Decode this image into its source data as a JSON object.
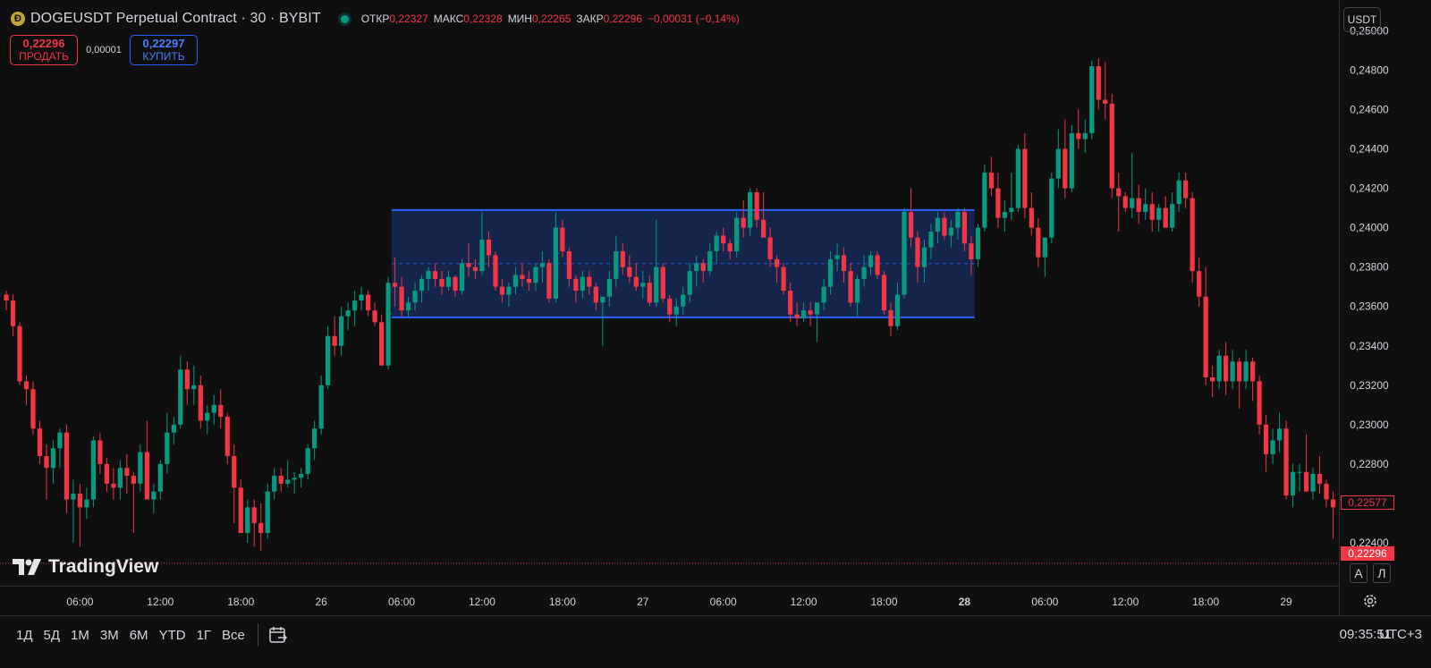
{
  "header": {
    "coin_glyph": "Ð",
    "symbol_title": "DOGEUSDT Perpetual Contract · 30 · BYBIT",
    "ohlc": {
      "open_label": "ОТКР",
      "open_value": "0,22327",
      "high_label": "МАКС",
      "high_value": "0,22328",
      "low_label": "МИН",
      "low_value": "0,22265",
      "close_label": "ЗАКР",
      "close_value": "0,22296",
      "change_value": "−0,00031 (−0,14%)"
    }
  },
  "trade": {
    "sell_price": "0,22296",
    "sell_label": "ПРОДАТЬ",
    "spread": "0,00001",
    "buy_price": "0,22297",
    "buy_label": "КУПИТЬ"
  },
  "currency": "USDT",
  "brand": "TradingView",
  "price_scale_modes": {
    "auto": "A",
    "log": "Л"
  },
  "price_tags": {
    "countdown_price": "0,22577",
    "last_price": "0,22296"
  },
  "timeframes": [
    "1Д",
    "5Д",
    "1М",
    "3М",
    "6М",
    "YTD",
    "1Г",
    "Все"
  ],
  "clock": {
    "time": "09:35:51",
    "tz": "UTC+3"
  },
  "colors": {
    "up": "#089981",
    "down": "#f23645",
    "rectangle": "#2962ff",
    "background": "#0f0f0f"
  },
  "chart_data": {
    "type": "candlestick",
    "interval": "30",
    "y_ticks": [
      "0,25000",
      "0,24800",
      "0,24600",
      "0,24400",
      "0,24200",
      "0,24000",
      "0,23800",
      "0,23600",
      "0,23400",
      "0,23200",
      "0,23000",
      "0,22800",
      "0,22600",
      "0,22400"
    ],
    "y_tick_values": [
      0.25,
      0.248,
      0.246,
      0.244,
      0.242,
      0.24,
      0.238,
      0.236,
      0.234,
      0.232,
      0.23,
      0.228,
      0.226,
      0.224
    ],
    "ylim": [
      0.2225,
      0.2512
    ],
    "x_ticks": [
      {
        "label": "06:00",
        "bar": 11,
        "bold": false
      },
      {
        "label": "12:00",
        "bar": 23,
        "bold": false
      },
      {
        "label": "18:00",
        "bar": 35,
        "bold": false
      },
      {
        "label": "26",
        "bar": 47,
        "bold": false
      },
      {
        "label": "06:00",
        "bar": 59,
        "bold": false
      },
      {
        "label": "12:00",
        "bar": 71,
        "bold": false
      },
      {
        "label": "18:00",
        "bar": 83,
        "bold": false
      },
      {
        "label": "27",
        "bar": 95,
        "bold": false
      },
      {
        "label": "06:00",
        "bar": 107,
        "bold": false
      },
      {
        "label": "12:00",
        "bar": 119,
        "bold": false
      },
      {
        "label": "18:00",
        "bar": 131,
        "bold": false
      },
      {
        "label": "28",
        "bar": 143,
        "bold": true
      },
      {
        "label": "06:00",
        "bar": 155,
        "bold": false
      },
      {
        "label": "12:00",
        "bar": 167,
        "bold": false
      },
      {
        "label": "18:00",
        "bar": 179,
        "bold": false
      },
      {
        "label": "29",
        "bar": 191,
        "bold": false
      }
    ],
    "rectangle": {
      "bar_start": 57.5,
      "bar_end": 144.5,
      "top": 0.2409,
      "bottom": 0.23545,
      "mid": 0.23818
    },
    "last_price": 0.22296,
    "candles": [
      [
        0.2366,
        0.2368,
        0.2358,
        0.2363
      ],
      [
        0.2363,
        0.2366,
        0.2345,
        0.235
      ],
      [
        0.235,
        0.2352,
        0.232,
        0.2322
      ],
      [
        0.2322,
        0.2325,
        0.231,
        0.2318
      ],
      [
        0.2318,
        0.2322,
        0.2295,
        0.2298
      ],
      [
        0.2298,
        0.2302,
        0.228,
        0.2284
      ],
      [
        0.2284,
        0.229,
        0.2262,
        0.2278
      ],
      [
        0.2278,
        0.2292,
        0.227,
        0.2288
      ],
      [
        0.2288,
        0.2298,
        0.2278,
        0.2296
      ],
      [
        0.2296,
        0.23,
        0.2255,
        0.2262
      ],
      [
        0.2262,
        0.2272,
        0.224,
        0.2265
      ],
      [
        0.2265,
        0.227,
        0.2238,
        0.2258
      ],
      [
        0.2258,
        0.2268,
        0.2252,
        0.2262
      ],
      [
        0.2262,
        0.2294,
        0.2258,
        0.2292
      ],
      [
        0.2292,
        0.2296,
        0.2275,
        0.228
      ],
      [
        0.228,
        0.2283,
        0.2266,
        0.227
      ],
      [
        0.227,
        0.2278,
        0.2262,
        0.2268
      ],
      [
        0.2268,
        0.2282,
        0.2262,
        0.2278
      ],
      [
        0.2278,
        0.2285,
        0.2265,
        0.2274
      ],
      [
        0.2274,
        0.2276,
        0.2245,
        0.227
      ],
      [
        0.227,
        0.229,
        0.2266,
        0.2286
      ],
      [
        0.2286,
        0.2302,
        0.228,
        0.2262
      ],
      [
        0.2262,
        0.227,
        0.2255,
        0.2266
      ],
      [
        0.2266,
        0.2282,
        0.2262,
        0.228
      ],
      [
        0.228,
        0.2306,
        0.2275,
        0.2296
      ],
      [
        0.2296,
        0.2304,
        0.229,
        0.23
      ],
      [
        0.23,
        0.2335,
        0.2298,
        0.2328
      ],
      [
        0.2328,
        0.2332,
        0.231,
        0.2318
      ],
      [
        0.2318,
        0.233,
        0.231,
        0.232
      ],
      [
        0.232,
        0.2325,
        0.2298,
        0.2302
      ],
      [
        0.2302,
        0.231,
        0.2295,
        0.2306
      ],
      [
        0.2306,
        0.2315,
        0.23,
        0.231
      ],
      [
        0.231,
        0.2318,
        0.2298,
        0.2304
      ],
      [
        0.2304,
        0.2306,
        0.228,
        0.2284
      ],
      [
        0.2284,
        0.229,
        0.225,
        0.2268
      ],
      [
        0.2268,
        0.2272,
        0.2245,
        0.2245
      ],
      [
        0.2245,
        0.2262,
        0.224,
        0.2258
      ],
      [
        0.2258,
        0.2262,
        0.2238,
        0.225
      ],
      [
        0.225,
        0.226,
        0.2236,
        0.2245
      ],
      [
        0.2245,
        0.227,
        0.2242,
        0.2266
      ],
      [
        0.2266,
        0.2278,
        0.2262,
        0.2274
      ],
      [
        0.2274,
        0.2278,
        0.2266,
        0.227
      ],
      [
        0.227,
        0.2282,
        0.2268,
        0.2272
      ],
      [
        0.2272,
        0.2276,
        0.2265,
        0.2273
      ],
      [
        0.2273,
        0.2278,
        0.2268,
        0.2275
      ],
      [
        0.2275,
        0.229,
        0.2272,
        0.2288
      ],
      [
        0.2288,
        0.2302,
        0.2282,
        0.2298
      ],
      [
        0.2298,
        0.2325,
        0.2295,
        0.232
      ],
      [
        0.232,
        0.235,
        0.2318,
        0.2345
      ],
      [
        0.2345,
        0.2355,
        0.2335,
        0.234
      ],
      [
        0.234,
        0.236,
        0.2335,
        0.2355
      ],
      [
        0.2355,
        0.2362,
        0.2348,
        0.2358
      ],
      [
        0.2358,
        0.2368,
        0.235,
        0.2363
      ],
      [
        0.2363,
        0.237,
        0.2358,
        0.2366
      ],
      [
        0.2366,
        0.2368,
        0.2355,
        0.2358
      ],
      [
        0.2358,
        0.2362,
        0.235,
        0.2352
      ],
      [
        0.2352,
        0.2356,
        0.233,
        0.233
      ],
      [
        0.233,
        0.2375,
        0.2328,
        0.2372
      ],
      [
        0.2372,
        0.2385,
        0.236,
        0.237
      ],
      [
        0.237,
        0.2375,
        0.2355,
        0.2358
      ],
      [
        0.2358,
        0.2365,
        0.2355,
        0.2362
      ],
      [
        0.2362,
        0.2372,
        0.2358,
        0.2368
      ],
      [
        0.2368,
        0.2376,
        0.2362,
        0.2374
      ],
      [
        0.2374,
        0.238,
        0.2368,
        0.2378
      ],
      [
        0.2378,
        0.2382,
        0.237,
        0.2374
      ],
      [
        0.2374,
        0.2378,
        0.2366,
        0.237
      ],
      [
        0.237,
        0.2378,
        0.2368,
        0.2375
      ],
      [
        0.2375,
        0.2376,
        0.2365,
        0.2368
      ],
      [
        0.2368,
        0.2384,
        0.2366,
        0.2382
      ],
      [
        0.2382,
        0.2392,
        0.2375,
        0.238
      ],
      [
        0.238,
        0.2384,
        0.2374,
        0.2378
      ],
      [
        0.2378,
        0.2408,
        0.2376,
        0.2394
      ],
      [
        0.2394,
        0.2398,
        0.238,
        0.2386
      ],
      [
        0.2386,
        0.2388,
        0.2368,
        0.237
      ],
      [
        0.237,
        0.2374,
        0.2362,
        0.2366
      ],
      [
        0.2366,
        0.2372,
        0.236,
        0.237
      ],
      [
        0.237,
        0.238,
        0.2366,
        0.2376
      ],
      [
        0.2376,
        0.2382,
        0.237,
        0.2374
      ],
      [
        0.2374,
        0.2378,
        0.2368,
        0.2372
      ],
      [
        0.2372,
        0.2382,
        0.2368,
        0.238
      ],
      [
        0.238,
        0.2388,
        0.2372,
        0.2382
      ],
      [
        0.2382,
        0.2384,
        0.2362,
        0.2364
      ],
      [
        0.2364,
        0.2408,
        0.2362,
        0.24
      ],
      [
        0.24,
        0.2404,
        0.2385,
        0.2388
      ],
      [
        0.2388,
        0.239,
        0.237,
        0.2374
      ],
      [
        0.2374,
        0.2376,
        0.2362,
        0.2368
      ],
      [
        0.2368,
        0.2378,
        0.2364,
        0.2375
      ],
      [
        0.2375,
        0.2378,
        0.2366,
        0.237
      ],
      [
        0.237,
        0.2372,
        0.2358,
        0.2362
      ],
      [
        0.2362,
        0.2364,
        0.234,
        0.2365
      ],
      [
        0.2365,
        0.2378,
        0.236,
        0.2374
      ],
      [
        0.2374,
        0.2396,
        0.237,
        0.2388
      ],
      [
        0.2388,
        0.2392,
        0.2376,
        0.238
      ],
      [
        0.238,
        0.2386,
        0.2372,
        0.2375
      ],
      [
        0.2375,
        0.2382,
        0.2368,
        0.237
      ],
      [
        0.237,
        0.2378,
        0.2364,
        0.2372
      ],
      [
        0.2372,
        0.2376,
        0.236,
        0.2362
      ],
      [
        0.2362,
        0.2404,
        0.236,
        0.238
      ],
      [
        0.238,
        0.2382,
        0.2362,
        0.2364
      ],
      [
        0.2364,
        0.2366,
        0.2352,
        0.2356
      ],
      [
        0.2356,
        0.2364,
        0.235,
        0.236
      ],
      [
        0.236,
        0.237,
        0.2356,
        0.2366
      ],
      [
        0.2366,
        0.2382,
        0.2362,
        0.2378
      ],
      [
        0.2378,
        0.2386,
        0.237,
        0.2382
      ],
      [
        0.2382,
        0.2384,
        0.2372,
        0.2378
      ],
      [
        0.2378,
        0.2392,
        0.2376,
        0.2388
      ],
      [
        0.2388,
        0.2398,
        0.2382,
        0.2396
      ],
      [
        0.2396,
        0.24,
        0.2388,
        0.2392
      ],
      [
        0.2392,
        0.2394,
        0.2384,
        0.2388
      ],
      [
        0.2388,
        0.2408,
        0.2385,
        0.2405
      ],
      [
        0.2405,
        0.2414,
        0.2395,
        0.24
      ],
      [
        0.24,
        0.242,
        0.2396,
        0.2418
      ],
      [
        0.2418,
        0.242,
        0.24,
        0.2404
      ],
      [
        0.2404,
        0.2418,
        0.24,
        0.2395
      ],
      [
        0.2395,
        0.24,
        0.238,
        0.2384
      ],
      [
        0.2384,
        0.2386,
        0.2372,
        0.238
      ],
      [
        0.238,
        0.2382,
        0.2366,
        0.2368
      ],
      [
        0.2368,
        0.2372,
        0.2352,
        0.2356
      ],
      [
        0.2356,
        0.2362,
        0.235,
        0.2354
      ],
      [
        0.2354,
        0.2362,
        0.2352,
        0.2358
      ],
      [
        0.2358,
        0.2362,
        0.235,
        0.2356
      ],
      [
        0.2356,
        0.2358,
        0.2342,
        0.2362
      ],
      [
        0.2362,
        0.2374,
        0.2358,
        0.237
      ],
      [
        0.237,
        0.2388,
        0.2366,
        0.2384
      ],
      [
        0.2384,
        0.2392,
        0.2378,
        0.2386
      ],
      [
        0.2386,
        0.239,
        0.2372,
        0.2378
      ],
      [
        0.2378,
        0.2382,
        0.236,
        0.2362
      ],
      [
        0.2362,
        0.2376,
        0.2355,
        0.2374
      ],
      [
        0.2374,
        0.2386,
        0.237,
        0.238
      ],
      [
        0.238,
        0.2388,
        0.2376,
        0.2386
      ],
      [
        0.2386,
        0.2388,
        0.2374,
        0.2376
      ],
      [
        0.2376,
        0.2378,
        0.2356,
        0.2358
      ],
      [
        0.2358,
        0.2362,
        0.2345,
        0.235
      ],
      [
        0.235,
        0.2372,
        0.2348,
        0.2366
      ],
      [
        0.2366,
        0.241,
        0.2364,
        0.2408
      ],
      [
        0.2408,
        0.242,
        0.239,
        0.2395
      ],
      [
        0.2395,
        0.2398,
        0.2372,
        0.238
      ],
      [
        0.238,
        0.2394,
        0.2372,
        0.239
      ],
      [
        0.239,
        0.2402,
        0.2384,
        0.2398
      ],
      [
        0.2398,
        0.2408,
        0.2392,
        0.2405
      ],
      [
        0.2405,
        0.2408,
        0.2394,
        0.2396
      ],
      [
        0.2396,
        0.2404,
        0.239,
        0.24
      ],
      [
        0.24,
        0.241,
        0.2394,
        0.2408
      ],
      [
        0.2408,
        0.241,
        0.2388,
        0.2392
      ],
      [
        0.2392,
        0.2396,
        0.2376,
        0.2384
      ],
      [
        0.2384,
        0.2402,
        0.238,
        0.24
      ],
      [
        0.24,
        0.2432,
        0.2398,
        0.2428
      ],
      [
        0.2428,
        0.2436,
        0.2416,
        0.242
      ],
      [
        0.242,
        0.2428,
        0.24,
        0.2405
      ],
      [
        0.2405,
        0.2414,
        0.2398,
        0.2408
      ],
      [
        0.2408,
        0.2428,
        0.2404,
        0.241
      ],
      [
        0.241,
        0.2442,
        0.2408,
        0.244
      ],
      [
        0.244,
        0.2448,
        0.2405,
        0.241
      ],
      [
        0.241,
        0.2418,
        0.2396,
        0.24
      ],
      [
        0.24,
        0.2405,
        0.238,
        0.2385
      ],
      [
        0.2385,
        0.2392,
        0.2375,
        0.2395
      ],
      [
        0.2395,
        0.2428,
        0.2392,
        0.2425
      ],
      [
        0.2425,
        0.245,
        0.242,
        0.244
      ],
      [
        0.244,
        0.2455,
        0.2415,
        0.242
      ],
      [
        0.242,
        0.2452,
        0.2418,
        0.2448
      ],
      [
        0.2448,
        0.246,
        0.244,
        0.2445
      ],
      [
        0.2445,
        0.2455,
        0.2438,
        0.2448
      ],
      [
        0.2448,
        0.2485,
        0.2445,
        0.2482
      ],
      [
        0.2482,
        0.2486,
        0.246,
        0.2465
      ],
      [
        0.2465,
        0.2484,
        0.2455,
        0.2463
      ],
      [
        0.2463,
        0.2468,
        0.2415,
        0.242
      ],
      [
        0.242,
        0.2428,
        0.2398,
        0.2416
      ],
      [
        0.2416,
        0.2418,
        0.2408,
        0.241
      ],
      [
        0.241,
        0.2438,
        0.2405,
        0.2415
      ],
      [
        0.2415,
        0.2422,
        0.2402,
        0.2408
      ],
      [
        0.2408,
        0.242,
        0.2404,
        0.2412
      ],
      [
        0.2412,
        0.2418,
        0.2398,
        0.2404
      ],
      [
        0.2404,
        0.2412,
        0.2398,
        0.241
      ],
      [
        0.241,
        0.2416,
        0.24,
        0.24
      ],
      [
        0.24,
        0.2418,
        0.2398,
        0.2412
      ],
      [
        0.2412,
        0.2428,
        0.2408,
        0.2424
      ],
      [
        0.2424,
        0.2428,
        0.241,
        0.2415
      ],
      [
        0.2415,
        0.2418,
        0.2372,
        0.2378
      ],
      [
        0.2378,
        0.2385,
        0.236,
        0.2365
      ],
      [
        0.2365,
        0.238,
        0.232,
        0.2324
      ],
      [
        0.2324,
        0.233,
        0.2314,
        0.2322
      ],
      [
        0.2322,
        0.2338,
        0.2318,
        0.2335
      ],
      [
        0.2335,
        0.2342,
        0.2315,
        0.2322
      ],
      [
        0.2322,
        0.2338,
        0.2318,
        0.2332
      ],
      [
        0.2332,
        0.2334,
        0.2308,
        0.2322
      ],
      [
        0.2322,
        0.2338,
        0.2318,
        0.2332
      ],
      [
        0.2332,
        0.2334,
        0.2312,
        0.2322
      ],
      [
        0.2322,
        0.2325,
        0.2295,
        0.23
      ],
      [
        0.23,
        0.2305,
        0.2276,
        0.2285
      ],
      [
        0.2285,
        0.2298,
        0.228,
        0.2292
      ],
      [
        0.2292,
        0.2306,
        0.2286,
        0.2298
      ],
      [
        0.2298,
        0.2302,
        0.2262,
        0.2264
      ],
      [
        0.2264,
        0.228,
        0.2258,
        0.2276
      ],
      [
        0.2276,
        0.228,
        0.2266,
        0.2276
      ],
      [
        0.2276,
        0.2295,
        0.2268,
        0.2266
      ],
      [
        0.2266,
        0.2278,
        0.2262,
        0.2275
      ],
      [
        0.2275,
        0.2284,
        0.2265,
        0.227
      ],
      [
        0.227,
        0.2272,
        0.2258,
        0.2262
      ],
      [
        0.2262,
        0.2266,
        0.2242,
        0.2258
      ]
    ]
  }
}
